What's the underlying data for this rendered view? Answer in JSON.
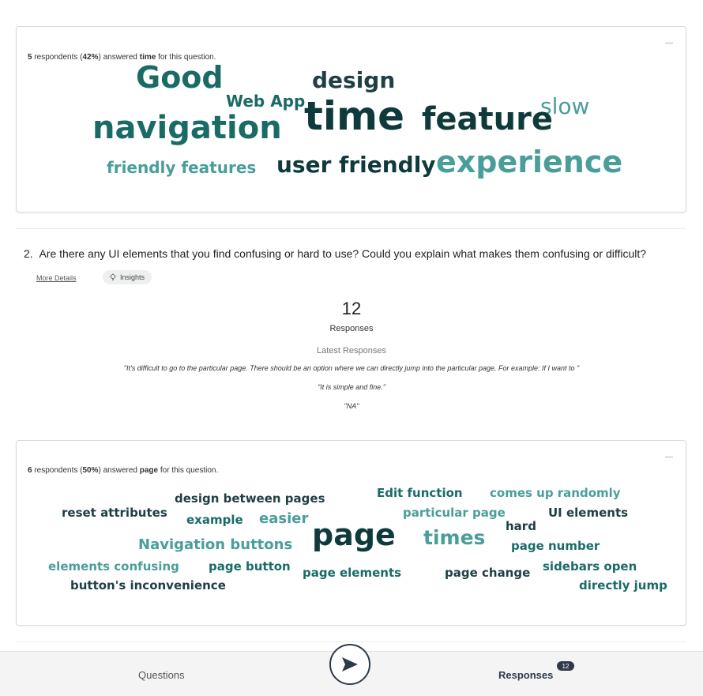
{
  "card1": {
    "summary": {
      "count": "5",
      "text1": " respondents (",
      "pct": "42%",
      "text2": ") answered ",
      "word": "time",
      "text3": " for this question."
    },
    "words": [
      {
        "text": "Good",
        "color": "#1a6b66"
      },
      {
        "text": "design",
        "color": "#1e3f43"
      },
      {
        "text": "Web App",
        "color": "#1a6b66"
      },
      {
        "text": "time",
        "color": "#0f3a3c"
      },
      {
        "text": "slow",
        "color": "#4a9e99"
      },
      {
        "text": "navigation",
        "color": "#1a6b66"
      },
      {
        "text": "feature",
        "color": "#0f3a3c"
      },
      {
        "text": "friendly features",
        "color": "#4a9e99"
      },
      {
        "text": "user friendly",
        "color": "#0f3a3c"
      },
      {
        "text": "experience",
        "color": "#4a9e99"
      }
    ]
  },
  "question2": {
    "number": "2.",
    "text": "Are there any UI elements that you find confusing or hard to use? Could you explain what makes them confusing or difficult?",
    "more_details": "More Details",
    "insights": "Insights",
    "count": "12",
    "responses_label": "Responses",
    "latest_label": "Latest Responses",
    "quotes": [
      "\"It's difficult to go to the particular page. There should be an option where we can directly jump into the particular page. For example: If I want to \"",
      "\"It is simple and fine.\"",
      "\"NA\""
    ]
  },
  "card2": {
    "summary": {
      "count": "6",
      "text1": " respondents (",
      "pct": "50%",
      "text2": ") answered ",
      "word": "page",
      "text3": " for this question."
    },
    "words": [
      {
        "text": "Edit function",
        "color": "#1a6b66"
      },
      {
        "text": "comes up randomly",
        "color": "#4a9e99"
      },
      {
        "text": "design between pages",
        "color": "#1e3f43"
      },
      {
        "text": "reset attributes",
        "color": "#1e3f43"
      },
      {
        "text": "particular page",
        "color": "#4a9e99"
      },
      {
        "text": "UI elements",
        "color": "#1e3f43"
      },
      {
        "text": "example",
        "color": "#1a6b66"
      },
      {
        "text": "easier",
        "color": "#4a9e99"
      },
      {
        "text": "page",
        "color": "#0f3a3c"
      },
      {
        "text": "hard",
        "color": "#1e3f43"
      },
      {
        "text": "times",
        "color": "#4a9e99"
      },
      {
        "text": "Navigation buttons",
        "color": "#4a9e99"
      },
      {
        "text": "page number",
        "color": "#1a6b66"
      },
      {
        "text": "elements confusing",
        "color": "#4a9e99"
      },
      {
        "text": "page button",
        "color": "#1a6b66"
      },
      {
        "text": "sidebars open",
        "color": "#1a6b66"
      },
      {
        "text": "page elements",
        "color": "#1a6b66"
      },
      {
        "text": "page change",
        "color": "#1e3f43"
      },
      {
        "text": "button's inconvenience",
        "color": "#1e3f43"
      },
      {
        "text": "directly jump",
        "color": "#1a6b66"
      }
    ]
  },
  "bottom_nav": {
    "questions": "Questions",
    "responses": "Responses",
    "badge": "12",
    "send_icon": "send-icon"
  }
}
